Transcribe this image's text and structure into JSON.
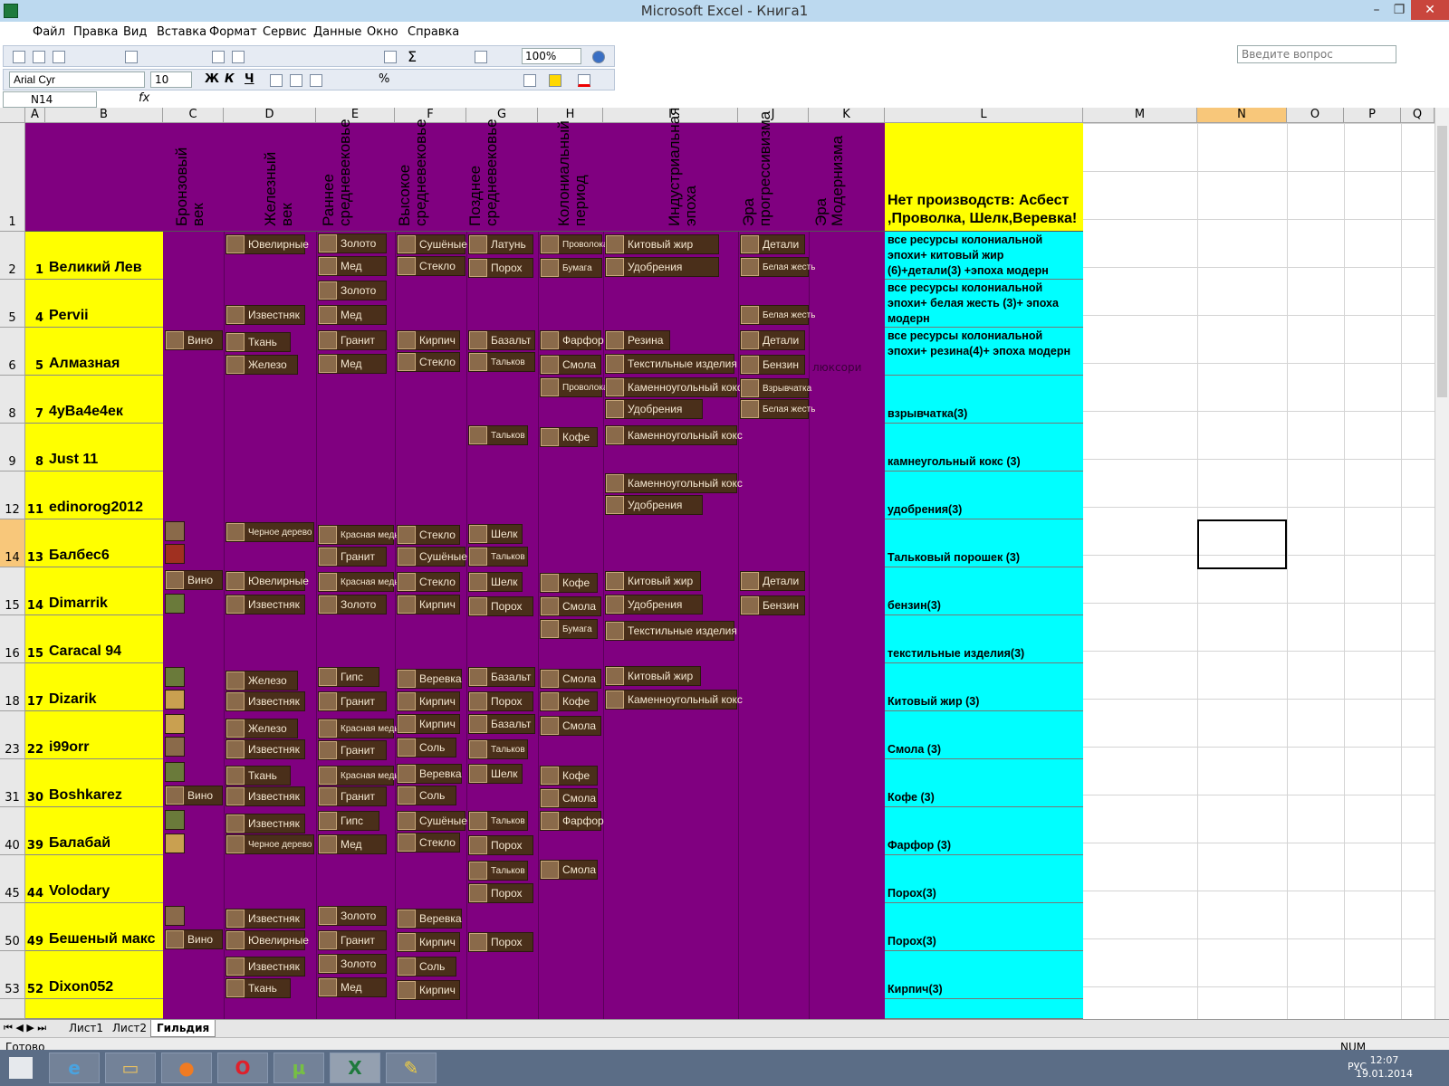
{
  "app": {
    "title": "Microsoft Excel - Книга1",
    "ask_placeholder": "Введите вопрос",
    "status": "Готово",
    "num": "NUM",
    "lang": "РУС",
    "time": "12:07",
    "date": "19.01.2014"
  },
  "menu": [
    "Файл",
    "Правка",
    "Вид",
    "Вставка",
    "Формат",
    "Сервис",
    "Данные",
    "Окно",
    "Справка"
  ],
  "toolbar": {
    "zoom": "100%",
    "font": "Arial Cyr",
    "size": "10",
    "bold": "Ж",
    "italic": "К",
    "underline": "Ч"
  },
  "formula_bar": {
    "cell_ref": "N14",
    "fx": "fx"
  },
  "columns": [
    "A",
    "B",
    "C",
    "D",
    "E",
    "F",
    "G",
    "H",
    "I",
    "J",
    "K",
    "L",
    "M",
    "N",
    "O",
    "P",
    "Q"
  ],
  "eras": [
    "Бронзовый век",
    "Железный век",
    "Раннее средневековье",
    "Высокое средневековье",
    "Позднее средневековье",
    "Колониальный период",
    "Индустриальная эпоха",
    "Эра прогрессивизма",
    "Эра Модернизма"
  ],
  "note_header": "Нет производств: Асбест ,Проволка, Шелк,Веревка!",
  "rows": [
    {
      "r": "2",
      "n": "1",
      "name": "Великий Лев",
      "note": "все ресурсы колониальной эпохи+ китовый жир (6)+детали(3) +эпоха модерн"
    },
    {
      "r": "5",
      "n": "4",
      "name": "Pervii",
      "note": "все ресурсы колониальной эпохи+ белая жесть (3)+ эпоха модерн"
    },
    {
      "r": "6",
      "n": "5",
      "name": "Алмазная",
      "note": "все ресурсы колониальной эпохи+ резина(4)+ эпоха модерн"
    },
    {
      "r": "8",
      "n": "7",
      "name": "4уВа4е4ек",
      "note": "взрывчатка(3)"
    },
    {
      "r": "9",
      "n": "8",
      "name": "Just 11",
      "note": "камнеугольный кокс (3)"
    },
    {
      "r": "12",
      "n": "11",
      "name": "edinorog2012",
      "note": "удобрения(3)"
    },
    {
      "r": "14",
      "n": "13",
      "name": "Балбес6",
      "note": "Тальковый порошек (3)"
    },
    {
      "r": "15",
      "n": "14",
      "name": "Dimarrik",
      "note": "бензин(3)"
    },
    {
      "r": "16",
      "n": "15",
      "name": "Caracal 94",
      "note": "текстильные изделия(3)"
    },
    {
      "r": "18",
      "n": "17",
      "name": "Dizarik",
      "note": "Китовый жир (3)"
    },
    {
      "r": "23",
      "n": "22",
      "name": "i99orr",
      "note": "Смола (3)"
    },
    {
      "r": "31",
      "n": "30",
      "name": "Boshkarez",
      "note": "Кофе (3)"
    },
    {
      "r": "40",
      "n": "39",
      "name": "Балабай",
      "note": "Фарфор (3)"
    },
    {
      "r": "45",
      "n": "44",
      "name": "Volodary",
      "note": "Порох(3)"
    },
    {
      "r": "50",
      "n": "49",
      "name": "Бешеный макс",
      "note": "Порох(3)"
    },
    {
      "r": "53",
      "n": "52",
      "name": "Dixon052",
      "note": "Кирпич(3)"
    }
  ],
  "items": {
    "i1": "Ювелирные",
    "i2": "Золото",
    "i3": "Сушёные",
    "i4": "Латунь",
    "i5": "Проволока",
    "i6": "Китовый жир",
    "i7": "Детали",
    "i8": "Мед",
    "i9": "Стекло",
    "i10": "Порох",
    "i11": "Бумага",
    "i12": "Удобрения",
    "i13": "Белая жесть",
    "i14": "Золото",
    "i15": "Известняк",
    "i16": "Мед",
    "i17": "Белая жесть",
    "i18": "Вино",
    "i19": "Ткань",
    "i20": "Гранит",
    "i21": "Кирпич",
    "i22": "Базальт",
    "i23": "Фарфор",
    "i24": "Резина",
    "i25": "Детали",
    "i26": "Железо",
    "i27": "Мед",
    "i28": "Стекло",
    "i29": "Тальков",
    "i30": "Смола",
    "i31": "Текстильные изделия",
    "i32": "Бензин",
    "i33": "люксори",
    "i34": "Проволока",
    "i35": "Каменноугольный кокс",
    "i36": "Взрывчатка",
    "i37": "Удобрения",
    "i38": "Белая жесть",
    "i39": "Тальков",
    "i40": "Кофе",
    "i41": "Каменноугольный кокс",
    "i42": "Каменноугольный кокс",
    "i43": "Удобрения",
    "i44": "Черное дерево",
    "i45": "Красная медь",
    "i46": "Стекло",
    "i47": "Шелк",
    "i48": "Гранит",
    "i49": "Сушёные",
    "i50": "Тальков",
    "i51": "Вино",
    "i52": "Ювелирные",
    "i53": "Красная медь",
    "i54": "Стекло",
    "i55": "Шелк",
    "i56": "Кофе",
    "i57": "Китовый жир",
    "i58": "Детали",
    "i59": "Известняк",
    "i60": "Золото",
    "i61": "Кирпич",
    "i62": "Порох",
    "i63": "Смола",
    "i64": "Удобрения",
    "i65": "Бензин",
    "i66": "Бумага",
    "i67": "Текстильные изделия",
    "i68": "Железо",
    "i69": "Гипс",
    "i70": "Веревка",
    "i71": "Базальт",
    "i72": "Смола",
    "i73": "Китовый жир",
    "i74": "Известняк",
    "i75": "Гранит",
    "i76": "Кирпич",
    "i77": "Порох",
    "i78": "Кофе",
    "i79": "Каменноугольный кокс",
    "i80": "Железо",
    "i81": "Красная медь",
    "i82": "Кирпич",
    "i83": "Базальт",
    "i84": "Смола",
    "i85": "Известняк",
    "i86": "Гранит",
    "i87": "Соль",
    "i88": "Тальков",
    "i89": "Ткань",
    "i90": "Красная медь",
    "i91": "Веревка",
    "i92": "Шелк",
    "i93": "Кофе",
    "i94": "Вино",
    "i95": "Известняк",
    "i96": "Гранит",
    "i97": "Соль",
    "i98": "Смола",
    "i99": "Известняк",
    "i100": "Гипс",
    "i101": "Сушёные",
    "i102": "Тальков",
    "i103": "Фарфор",
    "i104": "Черное дерево",
    "i105": "Мед",
    "i106": "Стекло",
    "i107": "Порох",
    "i108": "Тальков",
    "i109": "Смола",
    "i110": "Порох",
    "i111": "Известняк",
    "i112": "Золото",
    "i113": "Веревка",
    "i114": "Вино",
    "i115": "Ювелирные",
    "i116": "Гранит",
    "i117": "Кирпич",
    "i118": "Порох",
    "i119": "Известняк",
    "i120": "Золото",
    "i121": "Соль",
    "i122": "Ткань",
    "i123": "Мед",
    "i124": "Кирпич"
  },
  "sheets": [
    "Лист1",
    "Лист2",
    "Гильдия"
  ]
}
